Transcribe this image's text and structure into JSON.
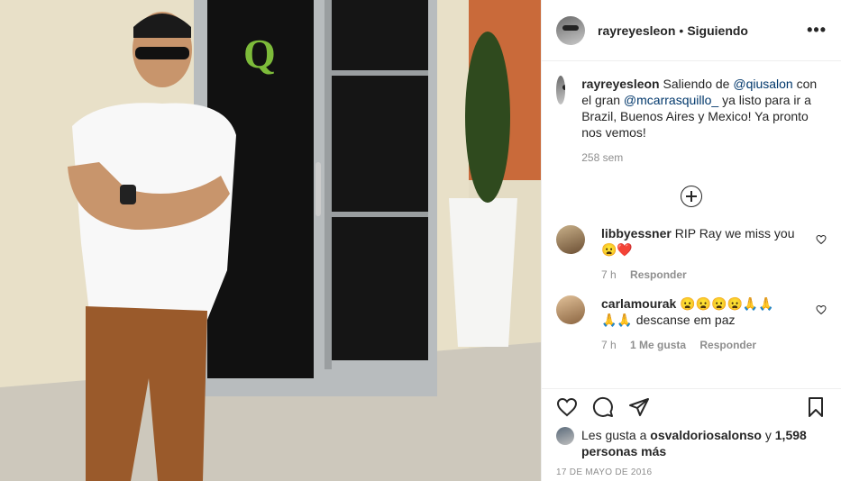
{
  "header": {
    "username": "rayreyesleon",
    "dot": "•",
    "follow_label": "Siguiendo",
    "more_icon": "more-icon"
  },
  "caption": {
    "username": "rayreyesleon",
    "text_1": "Saliendo de",
    "mention_1": "@qiusalon",
    "text_2": "con el gran",
    "mention_2": "@mcarrasquillo_",
    "text_3": "ya listo para ir a Brazil, Buenos Aires y Mexico! Ya pronto nos vemos!",
    "time": "258 sem"
  },
  "load_more_icon": "plus-circle-icon",
  "comments": [
    {
      "username": "libbyessner",
      "text": "RIP Ray we miss you",
      "emojis": "😦❤️",
      "time": "7 h",
      "likes": "",
      "reply_label": "Responder"
    },
    {
      "username": "carlamourak",
      "text_pre": "😦😦😦😦🙏🙏",
      "text_post": "🙏🙏 descanse em paz",
      "time": "7 h",
      "likes": "1 Me gusta",
      "reply_label": "Responder"
    }
  ],
  "actions": {
    "like_icon": "heart-icon",
    "comment_icon": "comment-icon",
    "share_icon": "share-icon",
    "save_icon": "bookmark-icon"
  },
  "likes": {
    "text_pre": "Les gusta a",
    "user": "osvaldoriosalonso",
    "conj": "y",
    "count": "1,598 personas más"
  },
  "date": "17 DE MAYO DE 2016",
  "colors": {
    "link": "#00376b",
    "meta": "#8e8e8e",
    "heart_red": "#ed4956"
  }
}
